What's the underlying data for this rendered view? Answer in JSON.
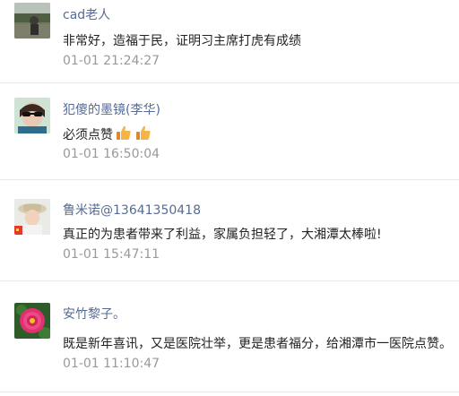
{
  "comments": [
    {
      "nickname": "cad老人",
      "text": "非常好，造福于民，证明习主席打虎有成绩",
      "time": "01-01 21:24:27"
    },
    {
      "nickname": "犯傻的墨镜(李华)",
      "text": "必须点赞",
      "emoji": [
        "thumbs-up-icon",
        "thumbs-up-icon"
      ],
      "time": "01-01 16:50:04"
    },
    {
      "nickname": "鲁米诺@13641350418",
      "text": "真正的为患者带来了利益，家属负担轻了，大湘潭太棒啦!",
      "time": "01-01 15:47:11"
    },
    {
      "nickname": "安竹黎子。",
      "text": "既是新年喜讯，又是医院壮举，更是患者福分，给湘潭市一医院点赞。",
      "time": "01-01 11:10:47"
    }
  ],
  "colors": {
    "nickname": "#576b95",
    "time": "#999999",
    "divider": "#e9e9e9"
  }
}
